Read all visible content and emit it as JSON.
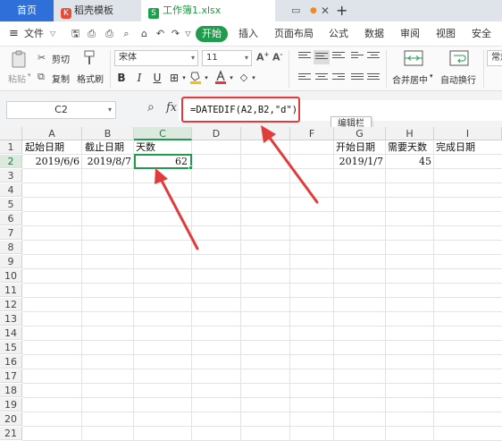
{
  "tabs": {
    "home": "首页",
    "template": "稻壳模板",
    "file": "工作簿1.xlsx"
  },
  "menu": {
    "file": "文件",
    "start": "开始",
    "ribbon_tabs": [
      "插入",
      "页面布局",
      "公式",
      "数据",
      "审阅",
      "视图",
      "安全"
    ]
  },
  "ribbon": {
    "cut": "剪切",
    "copy": "复制",
    "paste": "粘贴",
    "format_painter": "格式刷",
    "font_name": "宋体",
    "font_size": "11",
    "bold": "B",
    "italic": "I",
    "underline": "U",
    "merge_center": "合并居中",
    "auto_wrap": "自动换行",
    "general": "常规"
  },
  "formula_bar": {
    "cell_ref": "C2",
    "fx": "fx",
    "formula": "=DATEDIF(A2,B2,\"d\")",
    "tooltip": "编辑栏"
  },
  "grid": {
    "columns": [
      "A",
      "B",
      "C",
      "D",
      "E",
      "F",
      "G",
      "H",
      "I"
    ],
    "rows": [
      "1",
      "2",
      "3",
      "4",
      "5",
      "6",
      "7",
      "8",
      "9",
      "10",
      "11",
      "12",
      "13",
      "14",
      "15",
      "16",
      "17",
      "18",
      "19",
      "20",
      "21"
    ],
    "row1": {
      "A": "起始日期",
      "B": "截止日期",
      "C": "天数",
      "G": "开始日期",
      "H": "需要天数",
      "I": "完成日期"
    },
    "row2": {
      "A": "2019/6/6",
      "B": "2019/8/7",
      "C": "62",
      "G": "2019/1/7",
      "H": "45"
    }
  },
  "colors": {
    "accent": "#1f9d4c",
    "home_tab": "#2f6fda",
    "annotation": "#e23b3b"
  }
}
